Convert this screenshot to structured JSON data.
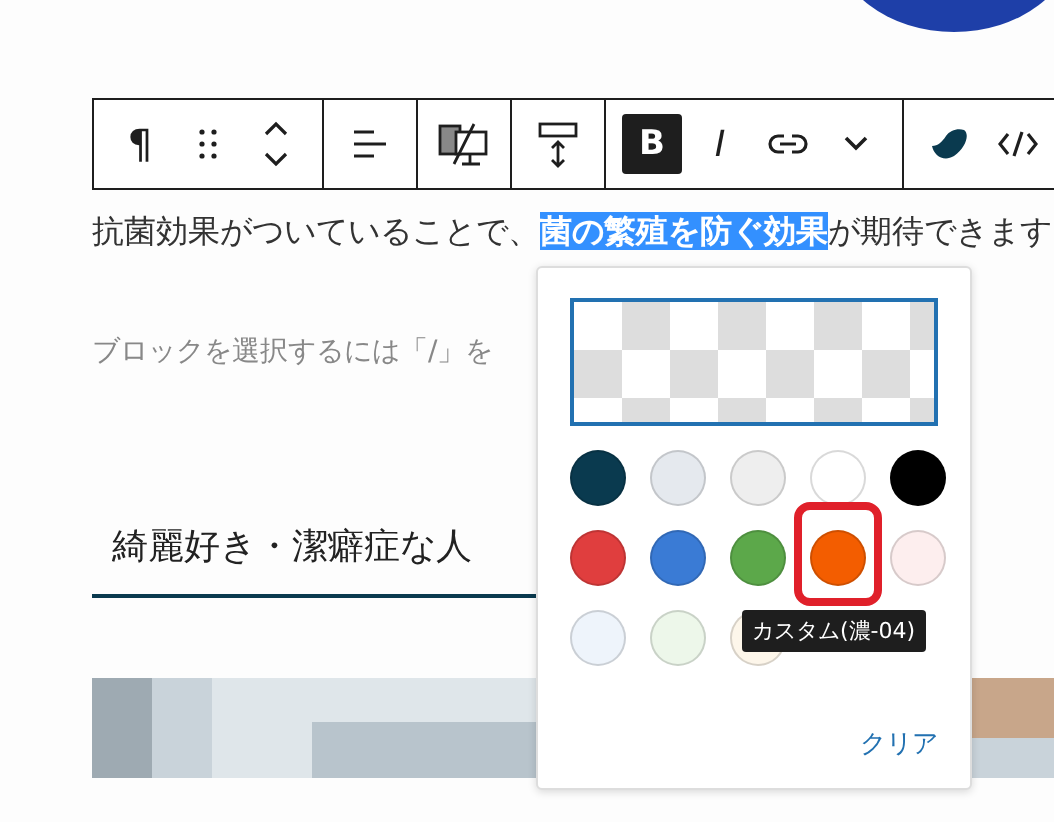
{
  "toolbar": {
    "groups": [
      {
        "items": [
          {
            "kind": "glyph",
            "label": "¶",
            "active": false
          },
          {
            "kind": "drag"
          },
          {
            "kind": "updown"
          }
        ]
      },
      {
        "items": [
          {
            "kind": "align"
          }
        ]
      },
      {
        "items": [
          {
            "kind": "device"
          }
        ]
      },
      {
        "items": [
          {
            "kind": "spacing"
          }
        ]
      },
      {
        "items": [
          {
            "kind": "bold",
            "label": "B",
            "active": true
          },
          {
            "kind": "italic",
            "label": "I",
            "active": false
          },
          {
            "kind": "link"
          },
          {
            "kind": "chevron"
          }
        ]
      },
      {
        "items": [
          {
            "kind": "droplet"
          },
          {
            "kind": "code"
          }
        ]
      }
    ]
  },
  "paragraph": {
    "before": "抗菌効果がついていることで、",
    "selected": "菌の繁殖を防ぐ効果",
    "after": "が期待できます"
  },
  "placeholder": "ブロックを選択するには「/」を",
  "heading": "綺麗好き・潔癖症な人",
  "color_popover": {
    "swatches": [
      {
        "color": "#0a3a4f",
        "marked": false
      },
      {
        "color": "#e5e9ee",
        "marked": false
      },
      {
        "color": "#eeeeee",
        "marked": false
      },
      {
        "color": "#ffffff",
        "marked": false
      },
      {
        "color": "#000000",
        "marked": false
      },
      {
        "color": "#e03e3e",
        "marked": false
      },
      {
        "color": "#3a7bd5",
        "marked": false
      },
      {
        "color": "#5ca84a",
        "marked": false
      },
      {
        "color": "#f35d00",
        "marked": true
      },
      {
        "color": "#fdeeee",
        "marked": false
      },
      {
        "color": "#eef4fb",
        "marked": false
      },
      {
        "color": "#edf7ea",
        "marked": false
      },
      {
        "color": "#fdf6ea",
        "marked": false
      }
    ],
    "tooltip": "カスタム(濃-04)",
    "clear": "クリア"
  }
}
